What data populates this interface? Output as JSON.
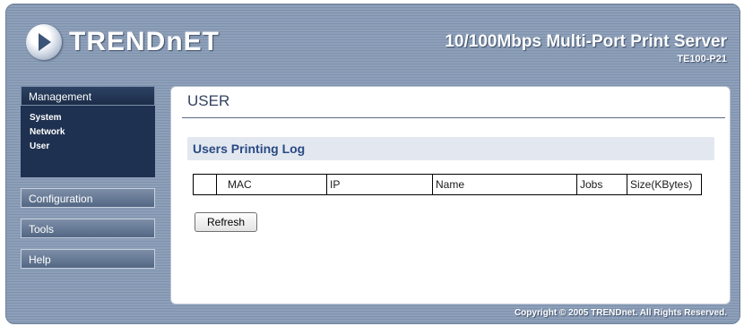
{
  "header": {
    "logo_text": "TRENDnET",
    "product_title": "10/100Mbps Multi-Port Print Server",
    "product_model": "TE100-P21"
  },
  "sidebar": {
    "management_label": "Management",
    "sub_items": [
      {
        "label": "System"
      },
      {
        "label": "Network"
      },
      {
        "label": "User"
      }
    ],
    "configuration_label": "Configuration",
    "tools_label": "Tools",
    "help_label": "Help"
  },
  "main": {
    "page_title": "USER",
    "section_title": "Users Printing Log",
    "table_headers": {
      "index": "",
      "mac": "MAC",
      "ip": "IP",
      "name": "Name",
      "jobs": "Jobs",
      "size": "Size(KBytes)"
    },
    "refresh_label": "Refresh"
  },
  "footer": {
    "copyright": "Copyright © 2005 TRENDnet. All Rights Reserved."
  }
}
